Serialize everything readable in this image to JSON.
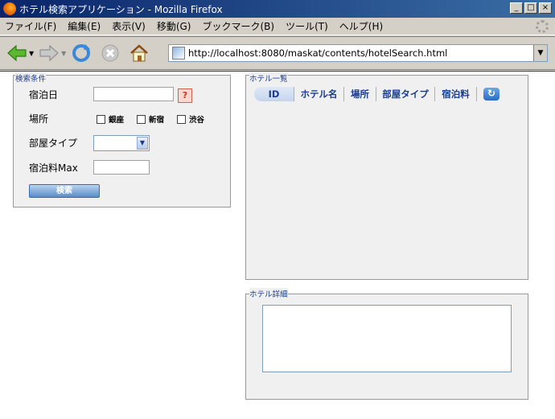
{
  "window": {
    "title": "ホテル検索アプリケーション - Mozilla Firefox",
    "minimize": "_",
    "maximize": "□",
    "close": "×"
  },
  "menu": {
    "items": [
      {
        "label": "ファイル(F)"
      },
      {
        "label": "編集(E)"
      },
      {
        "label": "表示(V)"
      },
      {
        "label": "移動(G)"
      },
      {
        "label": "ブックマーク(B)"
      },
      {
        "label": "ツール(T)"
      },
      {
        "label": "ヘルプ(H)"
      }
    ]
  },
  "toolbar": {
    "url": "http://localhost:8080/maskat/contents/hotelSearch.html",
    "icons": [
      "back-icon",
      "forward-icon",
      "reload-icon",
      "stop-icon",
      "home-icon"
    ]
  },
  "search_panel": {
    "title": "検索条件",
    "date_label": "宿泊日",
    "date_value": "",
    "help_label": "?",
    "location_label": "場所",
    "locations": [
      {
        "label": "銀座",
        "checked": false
      },
      {
        "label": "新宿",
        "checked": false
      },
      {
        "label": "渋谷",
        "checked": false
      }
    ],
    "room_type_label": "部屋タイプ",
    "room_type_value": "",
    "price_label": "宿泊料Max",
    "price_value": "",
    "search_button": "検索"
  },
  "list_panel": {
    "title": "ホテル一覧",
    "columns": [
      "ID",
      "ホテル名",
      "場所",
      "部屋タイプ",
      "宿泊料"
    ],
    "rows": []
  },
  "detail_panel": {
    "title": "ホテル詳細",
    "content": ""
  },
  "colors": {
    "panel_title": "#1a3d8c",
    "accent": "#3a6eaa"
  }
}
